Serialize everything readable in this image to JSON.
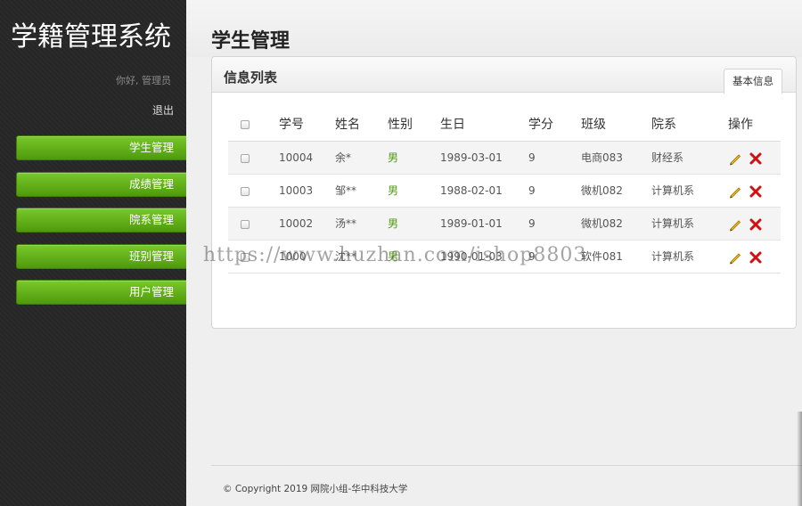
{
  "app": {
    "brand": "学籍管理系统",
    "greeting": "你好, 管理员",
    "logout": "退出"
  },
  "nav": {
    "items": [
      {
        "label": "学生管理"
      },
      {
        "label": "成绩管理"
      },
      {
        "label": "院系管理"
      },
      {
        "label": "班别管理"
      },
      {
        "label": "用户管理"
      }
    ]
  },
  "main": {
    "page_title": "学生管理",
    "panel_title": "信息列表",
    "tab_label": "基本信息"
  },
  "table": {
    "headers": {
      "id": "学号",
      "name": "姓名",
      "gender": "性别",
      "birthday": "生日",
      "credit": "学分",
      "class": "班级",
      "department": "院系",
      "actions": "操作"
    },
    "rows": [
      {
        "id": "10004",
        "name": "余*",
        "gender": "男",
        "birthday": "1989-03-01",
        "credit": "9",
        "class": "电商083",
        "department": "财经系"
      },
      {
        "id": "10003",
        "name": "邹**",
        "gender": "男",
        "birthday": "1988-02-01",
        "credit": "9",
        "class": "微机082",
        "department": "计算机系"
      },
      {
        "id": "10002",
        "name": "汤**",
        "gender": "男",
        "birthday": "1989-01-01",
        "credit": "9",
        "class": "微机082",
        "department": "计算机系"
      },
      {
        "id": "1000",
        "name": "沈**",
        "gender": "男",
        "birthday": "1990-01-03",
        "credit": "9",
        "class": "软件081",
        "department": "计算机系"
      }
    ]
  },
  "watermark": "https://www.huzhan.com/ishop8803",
  "footer": {
    "copyright": "© Copyright 2019 网院小组-华中科技大学"
  },
  "colors": {
    "nav_green": "#5ea916",
    "sidebar_bg": "#262626",
    "edit_icon": "#d9a400",
    "delete_icon": "#d01010"
  }
}
